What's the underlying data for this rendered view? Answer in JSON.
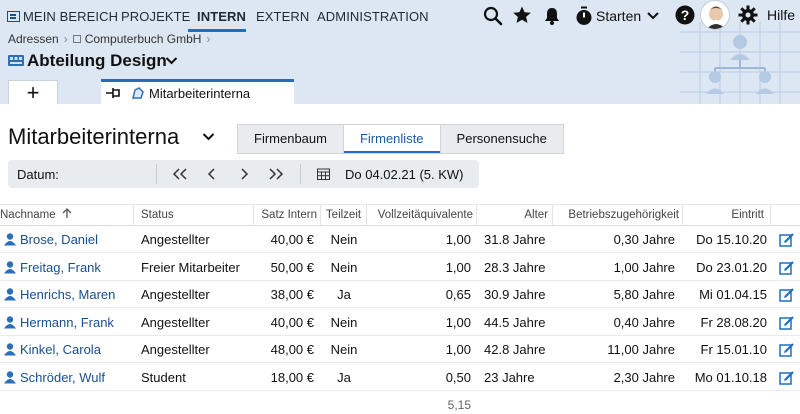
{
  "nav": {
    "items": [
      "MEIN BEREICH",
      "PROJEKTE",
      "INTERN",
      "EXTERN",
      "ADMINISTRATION"
    ],
    "active": "INTERN",
    "start_label": "Starten",
    "help_label": "Hilfe"
  },
  "breadcrumb": {
    "root": "Adressen",
    "company": "Computerbuch GmbH"
  },
  "department": {
    "label": "Abteilung Design"
  },
  "tabs": {
    "add": "+",
    "current": "Mitarbeiterinterna"
  },
  "page": {
    "title": "Mitarbeiterinterna"
  },
  "view_switch": {
    "options": [
      "Firmenbaum",
      "Firmenliste",
      "Personensuche"
    ],
    "selected": "Firmenliste"
  },
  "date_toolbar": {
    "label": "Datum:",
    "buttons": [
      "«",
      "‹",
      "›",
      "»"
    ],
    "date": "Do 04.02.21 (5. KW)"
  },
  "table": {
    "columns": [
      "Nachname",
      "Status",
      "Satz Intern",
      "Teilzeit",
      "Vollzeitäquivalente",
      "Alter",
      "Betriebszugehörigkeit",
      "Eintritt"
    ],
    "sort": {
      "column": "Nachname",
      "direction": "ascending"
    },
    "rows": [
      {
        "name": "Brose, Daniel",
        "status": "Angestellter",
        "rate": "40,00 €",
        "part_time": "Nein",
        "fte": "1,00",
        "age": "31.8 Jahre",
        "tenure": "0,30 Jahre",
        "entry": "Do 15.10.20"
      },
      {
        "name": "Freitag, Frank",
        "status": "Freier Mitarbeiter",
        "rate": "50,00 €",
        "part_time": "Nein",
        "fte": "1,00",
        "age": "28.3 Jahre",
        "tenure": "1,00 Jahre",
        "entry": "Do 23.01.20"
      },
      {
        "name": "Henrichs, Maren",
        "status": "Angestellter",
        "rate": "38,00 €",
        "part_time": "Ja",
        "fte": "0,65",
        "age": "30.9 Jahre",
        "tenure": "5,80 Jahre",
        "entry": "Mi 01.04.15"
      },
      {
        "name": "Hermann, Frank",
        "status": "Angestellter",
        "rate": "40,00 €",
        "part_time": "Nein",
        "fte": "1,00",
        "age": "44.5 Jahre",
        "tenure": "0,40 Jahre",
        "entry": "Fr 28.08.20"
      },
      {
        "name": "Kinkel, Carola",
        "status": "Angestellter",
        "rate": "48,00 €",
        "part_time": "Nein",
        "fte": "1,00",
        "age": "42.8 Jahre",
        "tenure": "11,00 Jahre",
        "entry": "Fr 15.01.10"
      },
      {
        "name": "Schröder, Wulf",
        "status": "Student",
        "rate": "18,00 €",
        "part_time": "Ja",
        "fte": "0,50",
        "age": "23 Jahre",
        "tenure": "2,30 Jahre",
        "entry": "Mo 01.10.18"
      }
    ],
    "footer_fte_total": "5,15"
  },
  "colors": {
    "accent": "#1e6fc0",
    "header_bg": "#dce7f3",
    "link": "#1a4f8e"
  },
  "icons": [
    "logo-icon",
    "search-icon",
    "star-icon",
    "bell-icon",
    "timer-icon",
    "chevron-down-icon",
    "help-icon",
    "avatar",
    "gear-icon",
    "company-icon",
    "department-icon",
    "pin-icon",
    "page-icon",
    "calendar-icon",
    "person-icon",
    "edit-icon",
    "sort-up-icon"
  ]
}
